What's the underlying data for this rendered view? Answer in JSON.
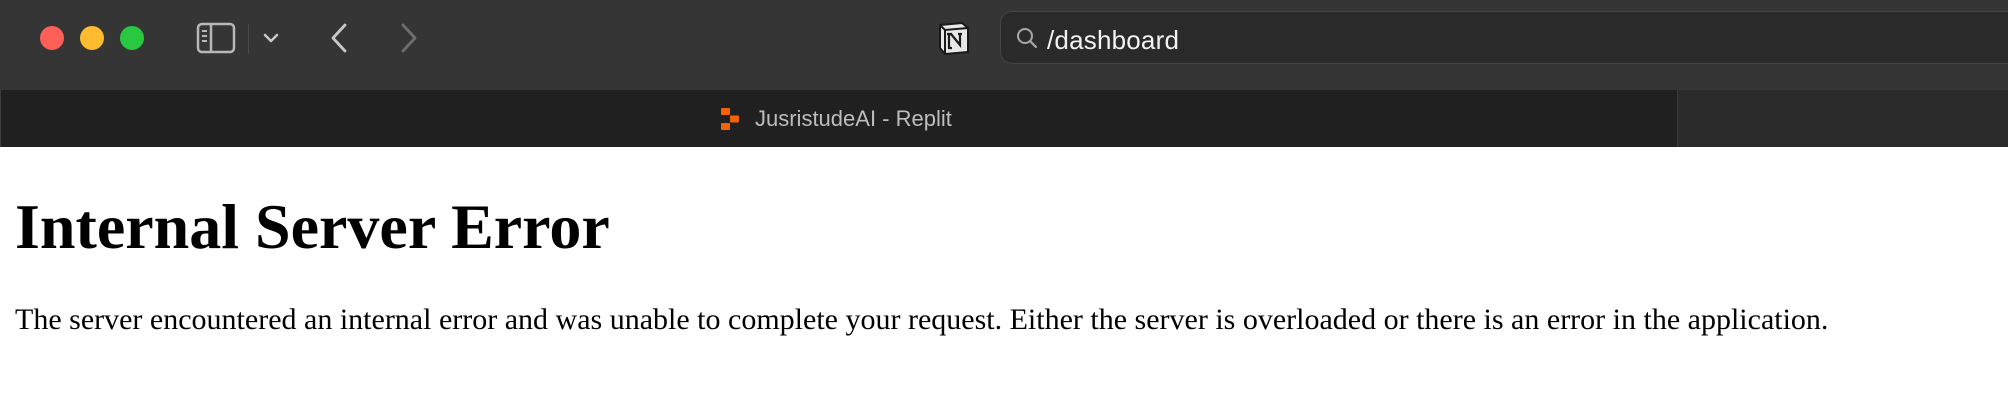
{
  "browser": {
    "url": "/dashboard",
    "tab_title": "JusristudeAI - Replit",
    "colors": {
      "close": "#fe5f57",
      "minimize": "#febc2e",
      "maximize": "#28c840",
      "replit_orange": "#f26207"
    },
    "icons": [
      "sidebar-toggle-icon",
      "chevron-down-icon",
      "back-arrow-icon",
      "forward-arrow-icon",
      "notion-icon",
      "search-icon",
      "replit-favicon"
    ]
  },
  "page": {
    "heading": "Internal Server Error",
    "message": "The server encountered an internal error and was unable to complete your request. Either the server is overloaded or there is an error in the application."
  }
}
